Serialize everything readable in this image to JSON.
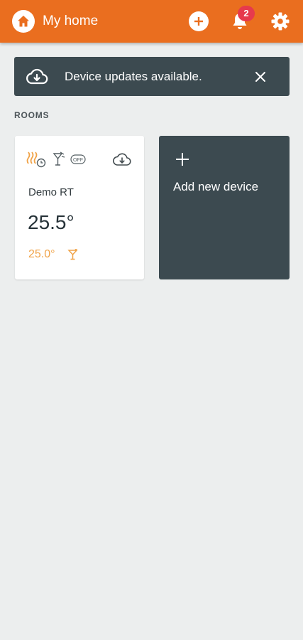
{
  "colors": {
    "appbar": "#ea6e1f",
    "background": "#eceeee",
    "banner": "#3c4a50",
    "badge": "#e63a4d",
    "setpoint": "#f0a348"
  },
  "header": {
    "title": "My home",
    "home_icon": "home-icon",
    "add_icon": "add-circle-icon",
    "bell_icon": "bell-icon",
    "notification_count": "2",
    "settings_icon": "gear-icon"
  },
  "banner": {
    "text": "Device updates available.",
    "icon": "cloud-download-icon",
    "close_icon": "close-icon"
  },
  "rooms": {
    "section_label": "ROOMS",
    "items": [
      {
        "name": "Demo RT",
        "temperature": "25.5°",
        "setpoint": "25.0°",
        "status_icons": [
          "heat-schedule-icon",
          "party-icon",
          "off-badge-icon"
        ],
        "off_label": "OFF",
        "cloud_icon": "cloud-download-icon",
        "mode_icon": "cocktail-icon"
      }
    ]
  },
  "add_device": {
    "label": "Add new device",
    "icon": "plus-icon"
  }
}
